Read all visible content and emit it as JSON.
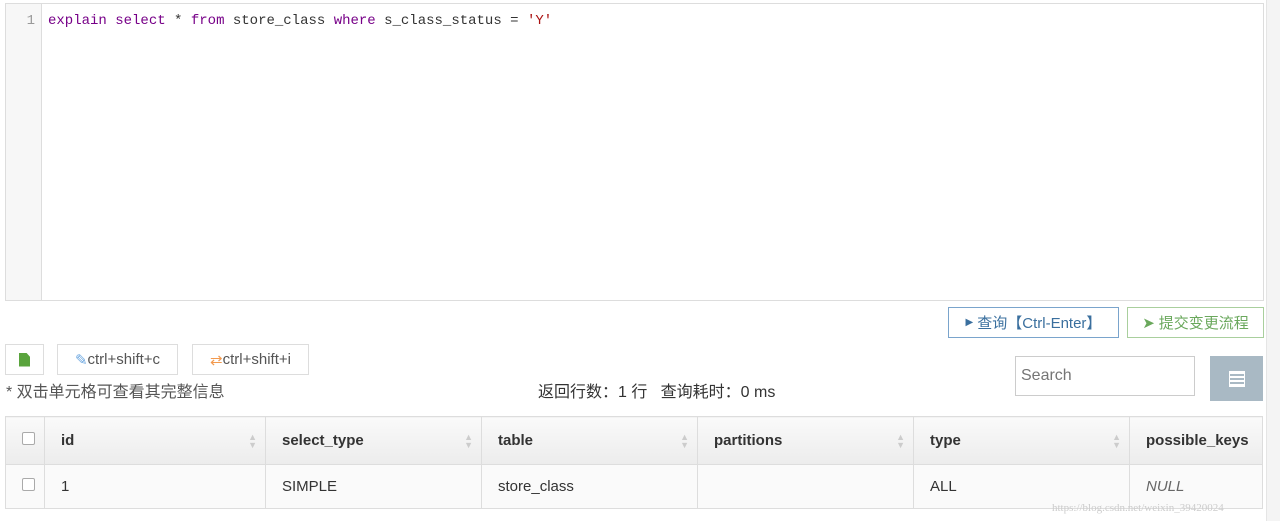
{
  "editor": {
    "line_number": "1",
    "tokens": [
      {
        "t": "explain",
        "c": "kw"
      },
      {
        "t": " "
      },
      {
        "t": "select",
        "c": "kw"
      },
      {
        "t": " * "
      },
      {
        "t": "from",
        "c": "kw"
      },
      {
        "t": " store_class "
      },
      {
        "t": "where",
        "c": "kw"
      },
      {
        "t": " s_class_status = "
      },
      {
        "t": "'Y'",
        "c": "str"
      }
    ]
  },
  "toolbar": {
    "query_label": "查询【Ctrl-Enter】",
    "submit_label": "提交变更流程",
    "copy_label": "ctrl+shift+c",
    "insert_label": "ctrl+shift+i"
  },
  "note": "* 双击单元格可查看其完整信息",
  "stats": "返回行数：1 行   查询耗时：0 ms",
  "search": {
    "placeholder": "Search"
  },
  "table": {
    "headers": [
      "id",
      "select_type",
      "table",
      "partitions",
      "type",
      "possible_keys"
    ],
    "rows": [
      [
        "1",
        "SIMPLE",
        "store_class",
        "",
        "ALL",
        "NULL"
      ]
    ]
  },
  "watermark": "https://blog.csdn.net/weixin_39420024"
}
